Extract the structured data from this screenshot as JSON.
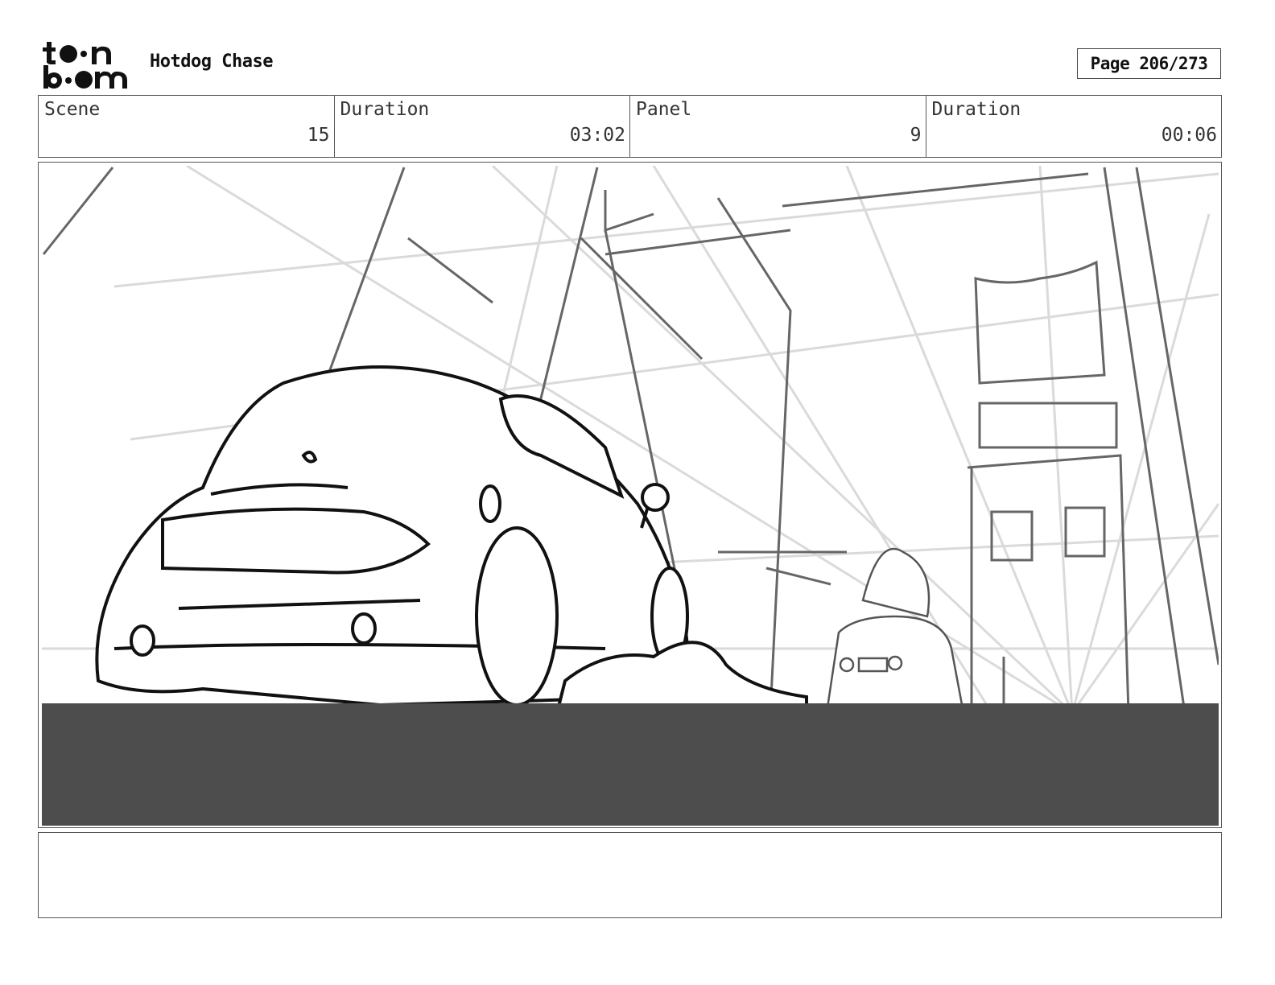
{
  "header": {
    "logo_text": "toon boom",
    "project_title": "Hotdog Chase",
    "page_label": "Page 206/273"
  },
  "info": {
    "scene_label": "Scene",
    "scene_value": "15",
    "scene_duration_label": "Duration",
    "scene_duration_value": "03:02",
    "panel_label": "Panel",
    "panel_value": "9",
    "panel_duration_label": "Duration",
    "panel_duration_value": "00:06"
  },
  "notes": {
    "text": ""
  }
}
